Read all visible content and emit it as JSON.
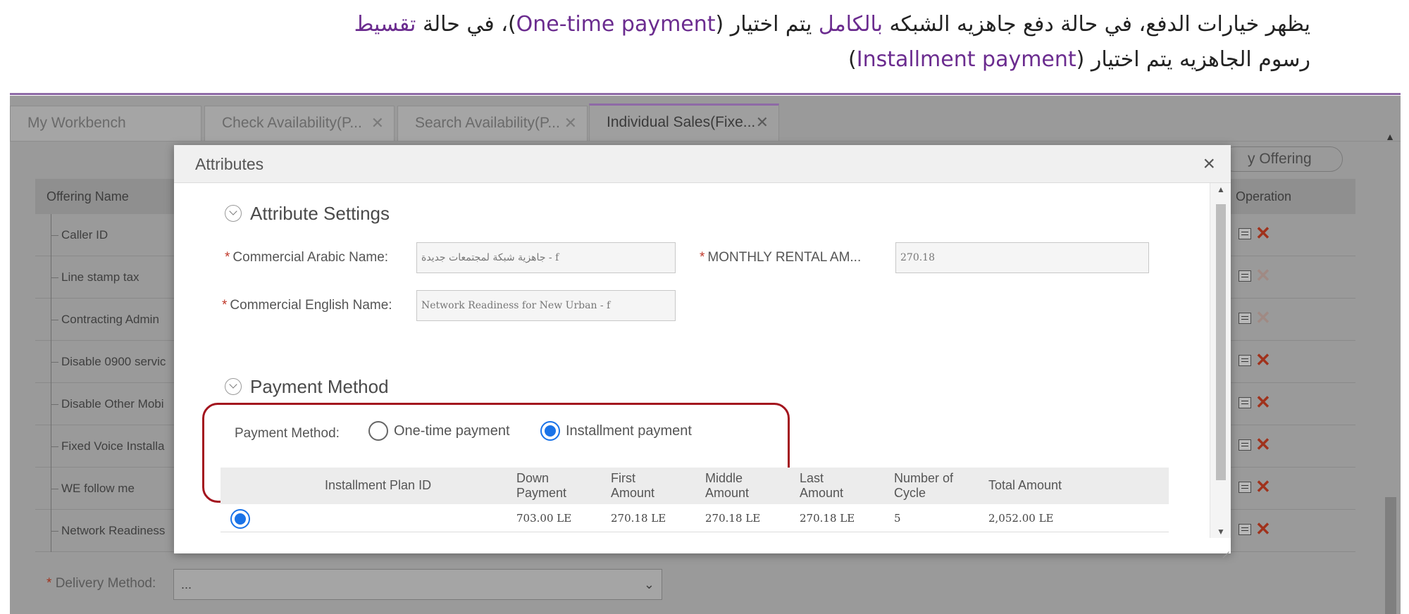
{
  "caption": {
    "line1": [
      {
        "text": "يظهر خيارات الدفع، في حالة دفع جاهزيه الشبكه ",
        "hl": false
      },
      {
        "text": "بالكامل",
        "hl": true
      },
      {
        "text": " يتم اختيار (",
        "hl": false
      },
      {
        "text": "One-time payment",
        "hl": true
      },
      {
        "text": ")، في حالة ",
        "hl": false
      },
      {
        "text": "تقسيط",
        "hl": true
      }
    ],
    "line2": [
      {
        "text": "رسوم الجاهزيه يتم اختيار (",
        "hl": false
      },
      {
        "text": "Installment payment",
        "hl": true
      },
      {
        "text": ")",
        "hl": false
      }
    ]
  },
  "tabs": [
    {
      "label": "My Workbench",
      "closable": false,
      "active": false
    },
    {
      "label": "Check Availability(P...",
      "closable": true,
      "active": false
    },
    {
      "label": "Search Availability(P...",
      "closable": true,
      "active": false
    },
    {
      "label": "Individual Sales(Fixe...",
      "closable": true,
      "active": true
    }
  ],
  "background": {
    "offering_button": "y Offering",
    "table_headers": {
      "offering_name": "Offering Name",
      "operation": "Operation"
    },
    "rows": [
      {
        "name": "Caller ID",
        "delete_enabled": true
      },
      {
        "name": "Line stamp tax",
        "delete_enabled": false
      },
      {
        "name": "Contracting Admin",
        "delete_enabled": false
      },
      {
        "name": "Disable 0900 servic",
        "delete_enabled": true
      },
      {
        "name": "Disable Other Mobi",
        "delete_enabled": true
      },
      {
        "name": "Fixed Voice Installa",
        "delete_enabled": true
      },
      {
        "name": "WE follow me",
        "delete_enabled": true
      },
      {
        "name": "Network Readiness",
        "delete_enabled": true
      }
    ],
    "delivery": {
      "label": "Delivery Method:",
      "value": "..."
    }
  },
  "modal": {
    "title": "Attributes",
    "close": "×",
    "attribute_settings": {
      "title": "Attribute Settings",
      "arabic_name_label": "Commercial Arabic Name:",
      "arabic_name_value": "جاهزية شبكة لمجتمعات جديدة - f",
      "monthly_label": "MONTHLY RENTAL AM...",
      "monthly_value": "270.18",
      "english_name_label": "Commercial English Name:",
      "english_name_value": "Network Readiness for New Urban - f"
    },
    "payment": {
      "title": "Payment Method",
      "label": "Payment Method:",
      "options": [
        {
          "label": "One-time payment",
          "checked": false
        },
        {
          "label": "Installment payment",
          "checked": true
        }
      ]
    },
    "installment_table": {
      "headers": {
        "plan_id": "Installment Plan ID",
        "down_1": "Down",
        "down_2": "Payment",
        "first_1": "First",
        "first_2": "Amount",
        "middle_1": "Middle",
        "middle_2": "Amount",
        "last_1": "Last",
        "last_2": "Amount",
        "cycle_1": "Number of",
        "cycle_2": "Cycle",
        "total": "Total Amount"
      },
      "row": {
        "selected": true,
        "plan_id": "",
        "down": "703.00 LE",
        "first": "270.18 LE",
        "middle": "270.18 LE",
        "last": "270.18 LE",
        "cycles": "5",
        "total": "2,052.00 LE"
      }
    }
  }
}
